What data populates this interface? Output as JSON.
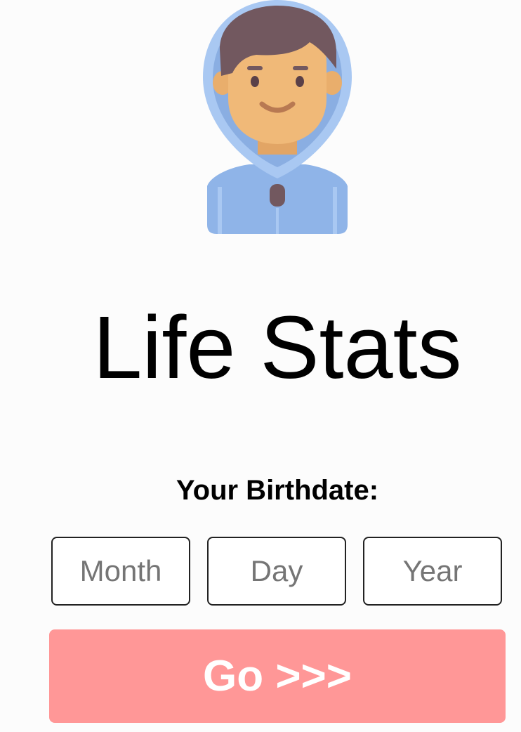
{
  "title": "Life Stats",
  "birthdate_label": "Your Birthdate:",
  "inputs": {
    "month": {
      "placeholder": "Month",
      "value": ""
    },
    "day": {
      "placeholder": "Day",
      "value": ""
    },
    "year": {
      "placeholder": "Year",
      "value": ""
    }
  },
  "go_button": {
    "label": "Go >>>"
  },
  "avatar": {
    "icon": "hooded-person-avatar"
  },
  "colors": {
    "background": "#fcfcfc",
    "button": "#ff9797",
    "hood": "#a9c8f2",
    "skin": "#f0b978",
    "hair": "#72585f"
  }
}
